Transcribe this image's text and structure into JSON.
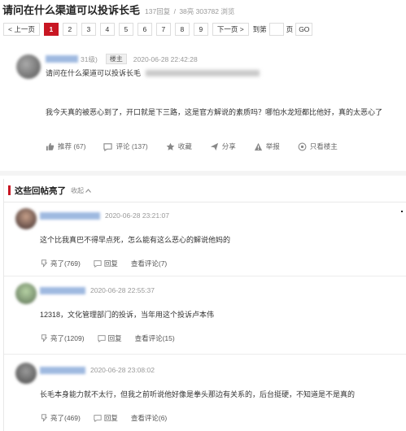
{
  "header": {
    "title": "请问在什么渠道可以投诉长毛",
    "replies": "137回复",
    "sep": "/",
    "views": "38亮 303782 浏览"
  },
  "pager": {
    "prev": "< 上一页",
    "pages": [
      "1",
      "2",
      "3",
      "4",
      "5",
      "6",
      "7",
      "8",
      "9"
    ],
    "current": "1",
    "next": "下一页 >",
    "goto_label": "到第",
    "page_unit": "页",
    "go": "GO"
  },
  "op": {
    "level": "31级)",
    "host_badge": "楼主",
    "time": "2020-06-28 22:42:28",
    "subtitle": "请问在什么渠道可以投诉长毛",
    "body": "我今天真的被恶心到了，开口就是下三路，这是官方解说的素质吗？哪怕水龙短都比他好，真的太恶心了",
    "actions": {
      "recommend": "推荐 (67)",
      "comment": "评论 (137)",
      "favorite": "收藏",
      "share": "分享",
      "report": "举报",
      "only_host": "只看楼主"
    }
  },
  "hot": {
    "title": "这些回帖亮了",
    "collapse": "收起",
    "replies": [
      {
        "time": "2020-06-28 23:21:07",
        "text": "这个比我真巴不得早点死，怎么能有这么恶心的解说他妈的",
        "light": "亮了(769)",
        "reply": "回复",
        "view_comments": "查看评论(7)"
      },
      {
        "time": "2020-06-28 22:55:37",
        "text": "12318，文化管理部门的投诉，当年用这个投诉卢本伟",
        "light": "亮了(1209)",
        "reply": "回复",
        "view_comments": "查看评论(15)"
      },
      {
        "time": "2020-06-28 23:08:02",
        "text": "长毛本身能力就不太行，但我之前听说他好像是拳头那边有关系的，后台挺硬，不知道是不是真的",
        "light": "亮了(469)",
        "reply": "回复",
        "view_comments": "查看评论(6)"
      }
    ]
  },
  "colors": {
    "accent": "#c81623",
    "muted": "#999999"
  }
}
